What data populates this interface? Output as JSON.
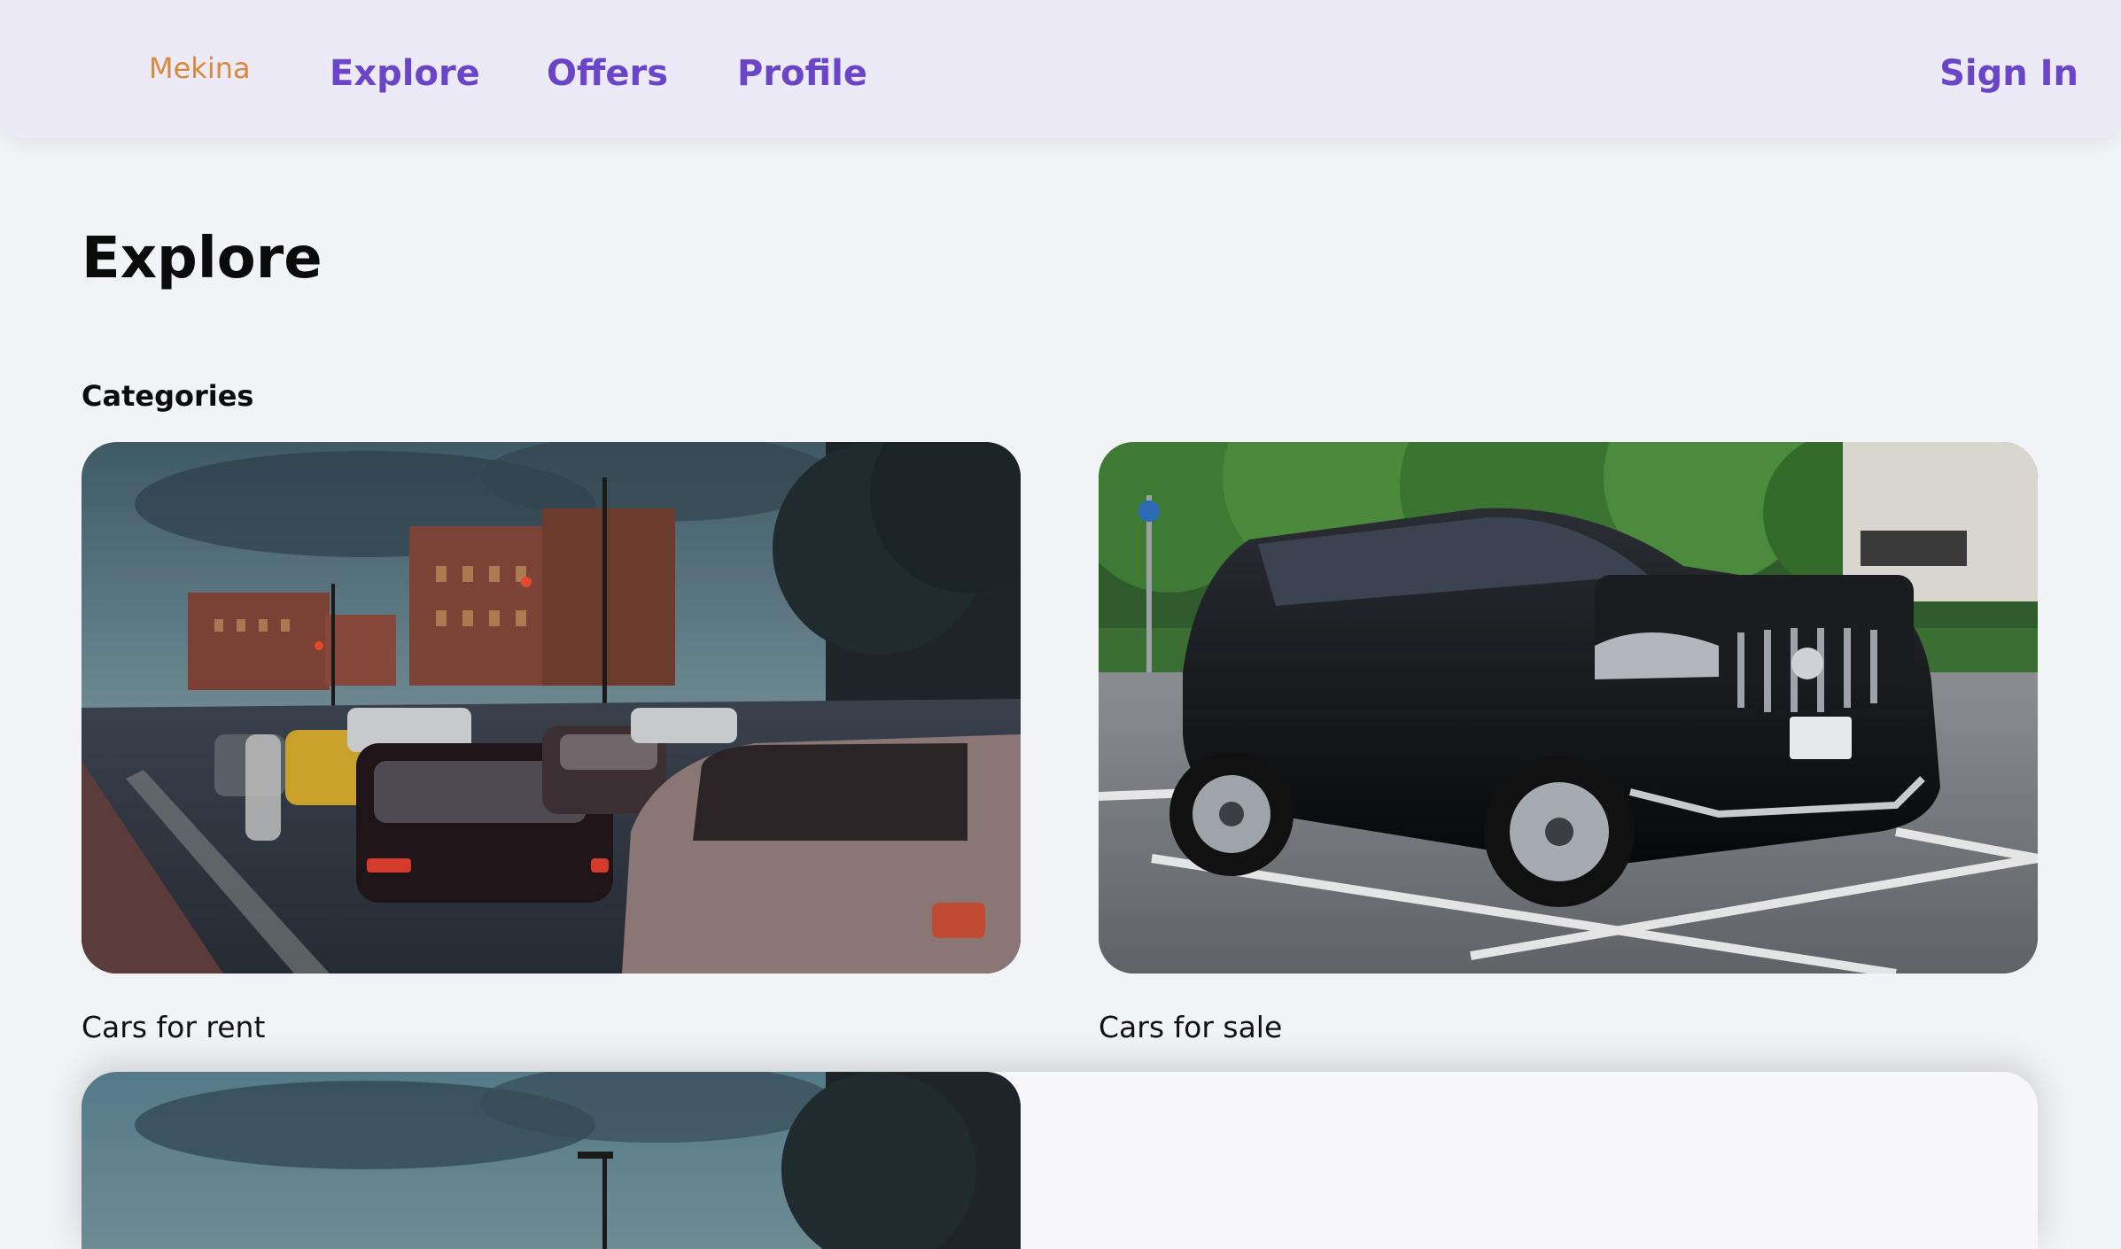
{
  "nav": {
    "brand": "Mekina",
    "links": [
      "Explore",
      "Offers",
      "Profile"
    ],
    "sign_in": "Sign In"
  },
  "page": {
    "title": "Explore",
    "section": "Categories"
  },
  "categories": [
    {
      "label": "Cars for rent",
      "image": "city-traffic-photo"
    },
    {
      "label": "Cars for sale",
      "image": "black-suv-photo"
    }
  ],
  "colors": {
    "accent": "#6a45c8",
    "brand": "#d88a3c",
    "nav_bg": "#eceaf7",
    "page_bg": "#f2f3f7"
  }
}
